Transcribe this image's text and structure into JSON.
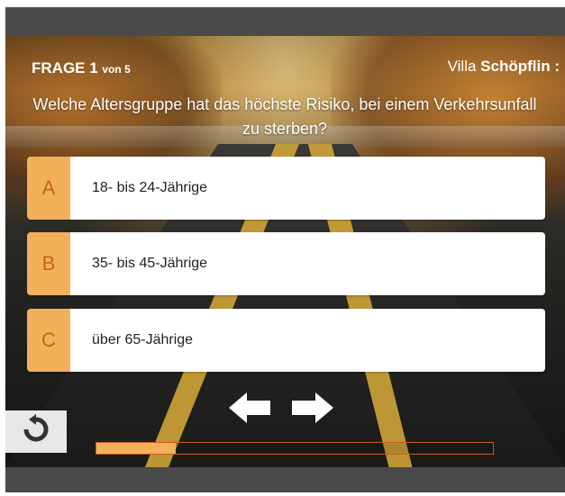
{
  "quiz": {
    "counter_label": "FRAGE 1",
    "counter_total": "von 5",
    "brand_prefix": "Villa",
    "brand_name": "Schöpflin :",
    "question": "Welche Altersgruppe hat das höchste Risiko, bei einem Verkehrsunfall zu sterben?",
    "answers": [
      {
        "letter": "A",
        "text": "18- bis 24-Jährige"
      },
      {
        "letter": "B",
        "text": "35- bis 45-Jährige"
      },
      {
        "letter": "C",
        "text": "über 65-Jährige"
      }
    ],
    "progress": 0.2
  },
  "icons": {
    "prev": "arrow-left-icon",
    "next": "arrow-right-icon",
    "reset": "refresh-icon"
  },
  "colors": {
    "accent": "#f3b05a",
    "accent_text": "#c0651c",
    "bar": "#4a4a4a"
  }
}
